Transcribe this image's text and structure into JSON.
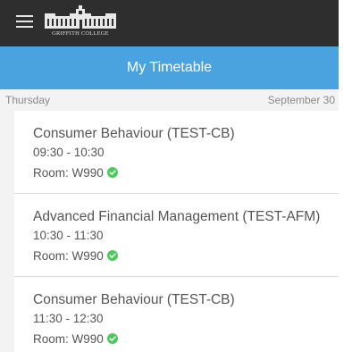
{
  "header": {
    "menu_icon": "hamburger-menu-icon",
    "logo_text": "GRIFFITH COLLEGE"
  },
  "page_title": "My Timetable",
  "day_header": {
    "day": "Thursday",
    "date": "September 30"
  },
  "classes": [
    {
      "course": "Consumer Behaviour (TEST-CB)",
      "time": "09:30 - 10:30",
      "room": "Room: W990",
      "status_icon": "check-circle-icon"
    },
    {
      "course": "Advanced Financial Management (TEST-AFM)",
      "time": "10:30 - 11:30",
      "room": "Room: W990",
      "status_icon": "check-circle-icon"
    },
    {
      "course": "Consumer Behaviour (TEST-CB)",
      "time": "11:30 - 12:30",
      "room": "Room: W990",
      "status_icon": "check-circle-icon"
    }
  ],
  "colors": {
    "topbar": "#2e2e2e",
    "titlebar": "#4aa3df",
    "check": "#4bc95b"
  }
}
